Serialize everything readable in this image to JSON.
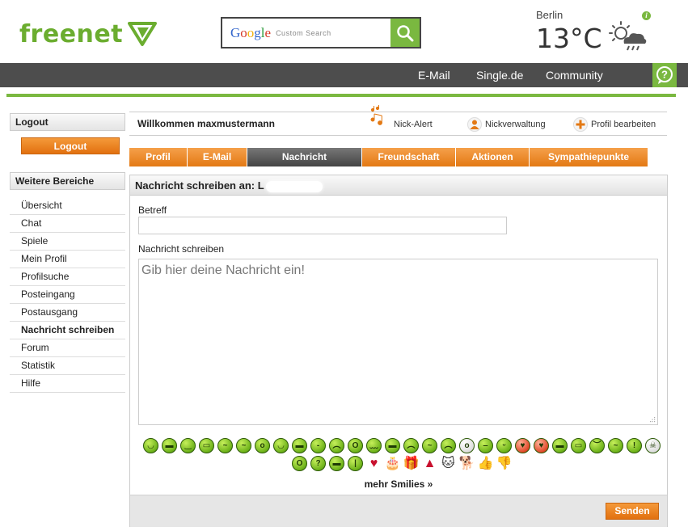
{
  "logo": {
    "text_part1": "free",
    "text_part2": "net",
    "brand_color": "#6bad2f"
  },
  "search": {
    "brand": "Google",
    "placeholder": "Custom Search"
  },
  "weather": {
    "city": "Berlin",
    "temperature": "13°C",
    "condition_icon": "sun-cloud-rain-icon",
    "info": "i"
  },
  "topnav": {
    "items": [
      "E-Mail",
      "Single.de",
      "Community"
    ],
    "help_icon": "question-icon"
  },
  "sidebar": {
    "logout_header": "Logout",
    "logout_button": "Logout",
    "more_header": "Weitere Bereiche",
    "items": [
      "Übersicht",
      "Chat",
      "Spiele",
      "Mein Profil",
      "Profilsuche",
      "Posteingang",
      "Postausgang",
      "Nachricht schreiben",
      "Forum",
      "Statistik",
      "Hilfe"
    ],
    "active_index": 7
  },
  "welcome": {
    "text": "Willkommen maxmustermann",
    "links": [
      "Nick-Alert",
      "Nickverwaltung",
      "Profil bearbeiten"
    ]
  },
  "tabs": {
    "items": [
      "Profil",
      "E-Mail",
      "Nachricht",
      "Freundschaft",
      "Aktionen",
      "Sympathiepunkte"
    ],
    "active_index": 2
  },
  "compose": {
    "heading": "Nachricht schreiben an: L",
    "subject_label": "Betreff",
    "subject_value": "",
    "message_label": "Nachricht schreiben",
    "message_placeholder": "Gib hier deine Nachricht ein!",
    "more_smilies": "mehr Smilies »",
    "send_button": "Senden"
  },
  "colors": {
    "accent_orange": "#e37914",
    "accent_green": "#7ab840",
    "nav_dark": "#4d4d4d"
  }
}
